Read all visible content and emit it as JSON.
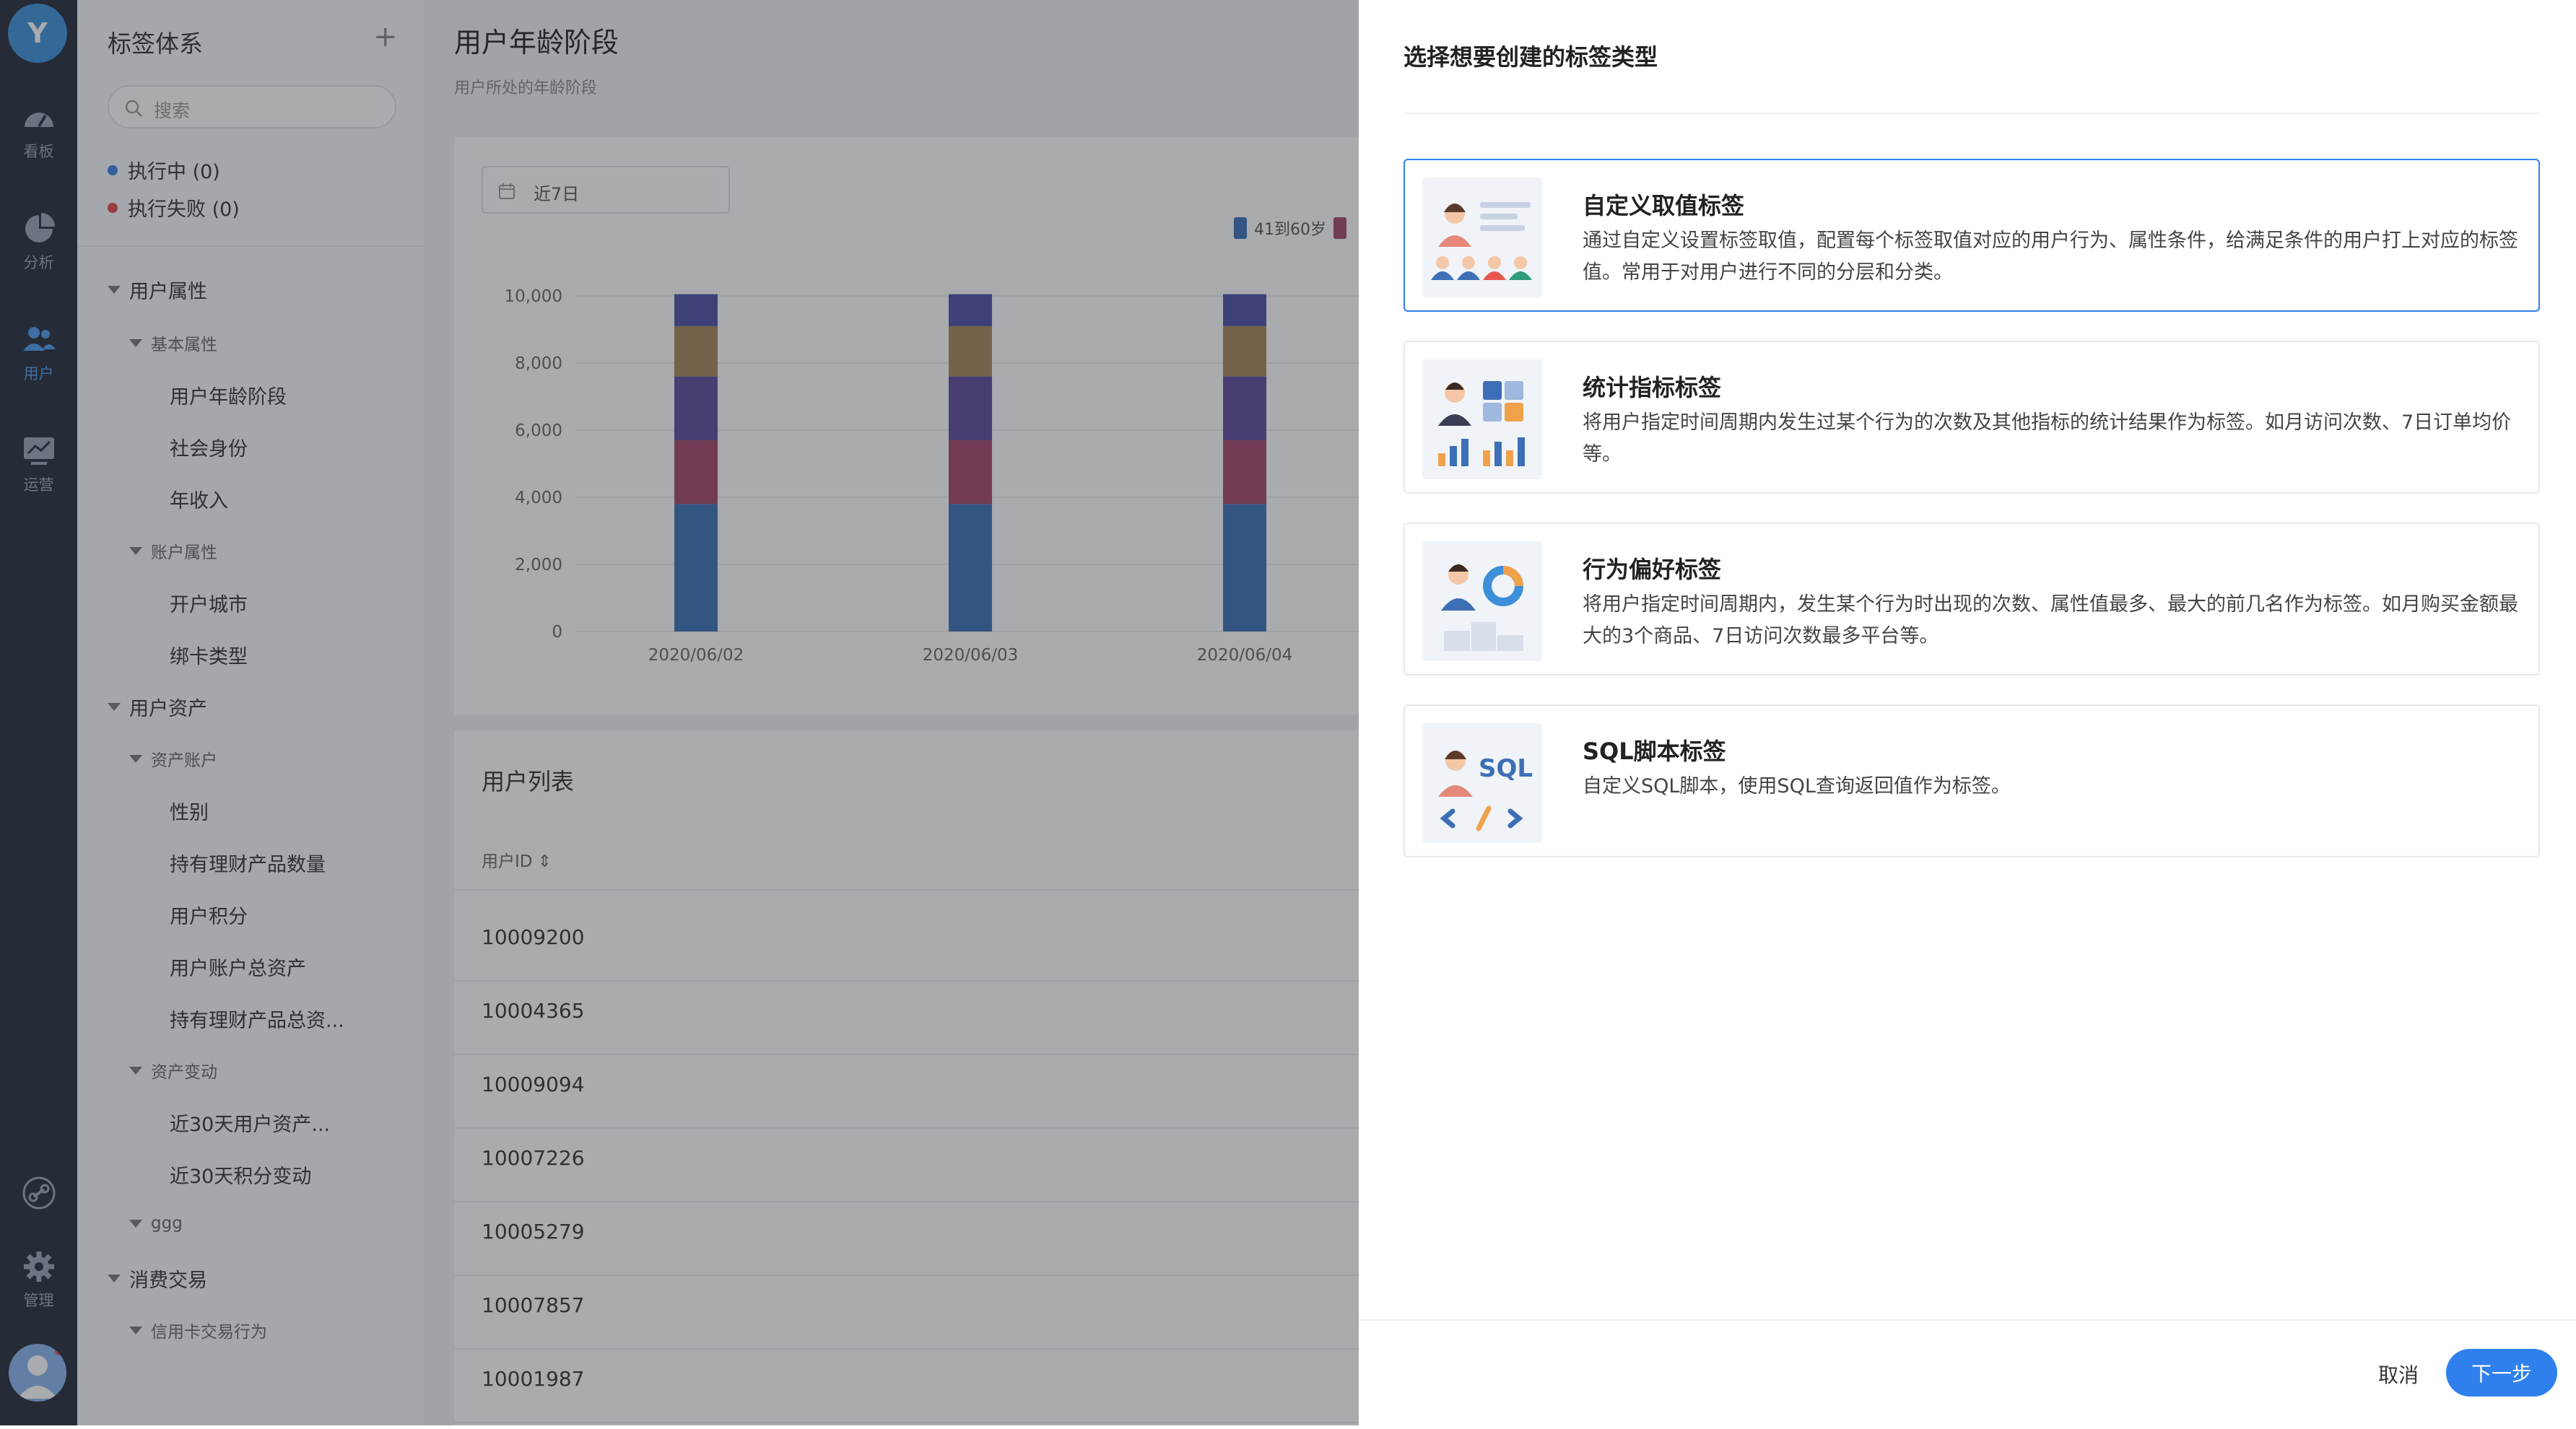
{
  "rail": {
    "logo": "Y",
    "items": [
      {
        "label": "看板",
        "icon": "dashboard-icon"
      },
      {
        "label": "分析",
        "icon": "pie-chart-icon"
      },
      {
        "label": "用户",
        "icon": "users-icon",
        "active": true
      },
      {
        "label": "运营",
        "icon": "monitor-chart-icon"
      }
    ],
    "link_icon": "link-icon",
    "manage": {
      "label": "管理",
      "icon": "gear-icon"
    },
    "avatar_icon": "user-avatar-icon"
  },
  "sidebar": {
    "title": "标签体系",
    "add_icon": "plus-icon",
    "search_placeholder": "搜索",
    "status": [
      {
        "label": "执行中 (0)",
        "color": "#3d7fe0"
      },
      {
        "label": "执行失败 (0)",
        "color": "#e8454c"
      }
    ],
    "tree": [
      {
        "label": "用户属性",
        "level": 0
      },
      {
        "label": "基本属性",
        "level": 1
      },
      {
        "label": "用户年龄阶段",
        "level": 2
      },
      {
        "label": "社会身份",
        "level": 2
      },
      {
        "label": "年收入",
        "level": 2
      },
      {
        "label": "账户属性",
        "level": 1
      },
      {
        "label": "开户城市",
        "level": 2
      },
      {
        "label": "绑卡类型",
        "level": 2
      },
      {
        "label": "用户资产",
        "level": 0
      },
      {
        "label": "资产账户",
        "level": 1
      },
      {
        "label": "性别",
        "level": 2
      },
      {
        "label": "持有理财产品数量",
        "level": 2
      },
      {
        "label": "用户积分",
        "level": 2
      },
      {
        "label": "用户账户总资产",
        "level": 2
      },
      {
        "label": "持有理财产品总资...",
        "level": 2
      },
      {
        "label": "资产变动",
        "level": 1
      },
      {
        "label": "近30天用户资产...",
        "level": 2
      },
      {
        "label": "近30天积分变动",
        "level": 2
      },
      {
        "label": "ggg",
        "level": 1
      },
      {
        "label": "消费交易",
        "level": 0
      },
      {
        "label": "信用卡交易行为",
        "level": 1
      }
    ]
  },
  "main": {
    "title": "用户年龄阶段",
    "subtitle": "用户所处的年龄阶段",
    "date_range": "近7日",
    "legend_label": "41到60岁",
    "list_title": "用户列表",
    "list_header": "用户ID ⇕",
    "user_ids": [
      "10009200",
      "10004365",
      "10009094",
      "10007226",
      "10005279",
      "10007857",
      "10001987"
    ]
  },
  "chart_data": {
    "type": "bar",
    "stacked": true,
    "categories": [
      "2020/06/02",
      "2020/06/03",
      "2020/06/04"
    ],
    "y_ticks": [
      "10,000",
      "8,000",
      "6,000",
      "4,000",
      "2,000",
      "0"
    ],
    "ylim": [
      0,
      10000
    ],
    "series": [
      {
        "name": "41到60岁",
        "color": "#3d6fb6",
        "values": [
          3800,
          3800,
          3800
        ]
      },
      {
        "name": "",
        "color": "#a4476a",
        "values": [
          1900,
          1900,
          1900
        ]
      },
      {
        "name": "",
        "color": "#5e4a99",
        "values": [
          1900,
          1900,
          1900
        ]
      },
      {
        "name": "",
        "color": "#a8855a",
        "values": [
          1500,
          1500,
          1500
        ]
      },
      {
        "name": "",
        "color": "#4b4fa6",
        "values": [
          950,
          950,
          950
        ]
      }
    ]
  },
  "drawer": {
    "title": "选择想要创建的标签类型",
    "options": [
      {
        "title": "自定义取值标签",
        "desc": "通过自定义设置标签取值，配置每个标签取值对应的用户行为、属性条件，给满足条件的用户打上对应的标签值。常用于对用户进行不同的分层和分类。",
        "icon": "custom-value-illustration-icon"
      },
      {
        "title": "统计指标标签",
        "desc": "将用户指定时间周期内发生过某个行为的次数及其他指标的统计结果作为标签。如月访问次数、7日订单均价等。",
        "icon": "statistics-illustration-icon"
      },
      {
        "title": "行为偏好标签",
        "desc": "将用户指定时间周期内，发生某个行为时出现的次数、属性值最多、最大的前几名作为标签。如月购买金额最大的3个商品、7日访问次数最多平台等。",
        "icon": "preference-illustration-icon"
      },
      {
        "title": "SQL脚本标签",
        "desc": "自定义SQL脚本，使用SQL查询返回值作为标签。",
        "icon": "sql-illustration-icon",
        "sql_word": "SQL"
      }
    ],
    "cancel": "取消",
    "next": "下一步",
    "accent": "#2f80ed"
  }
}
